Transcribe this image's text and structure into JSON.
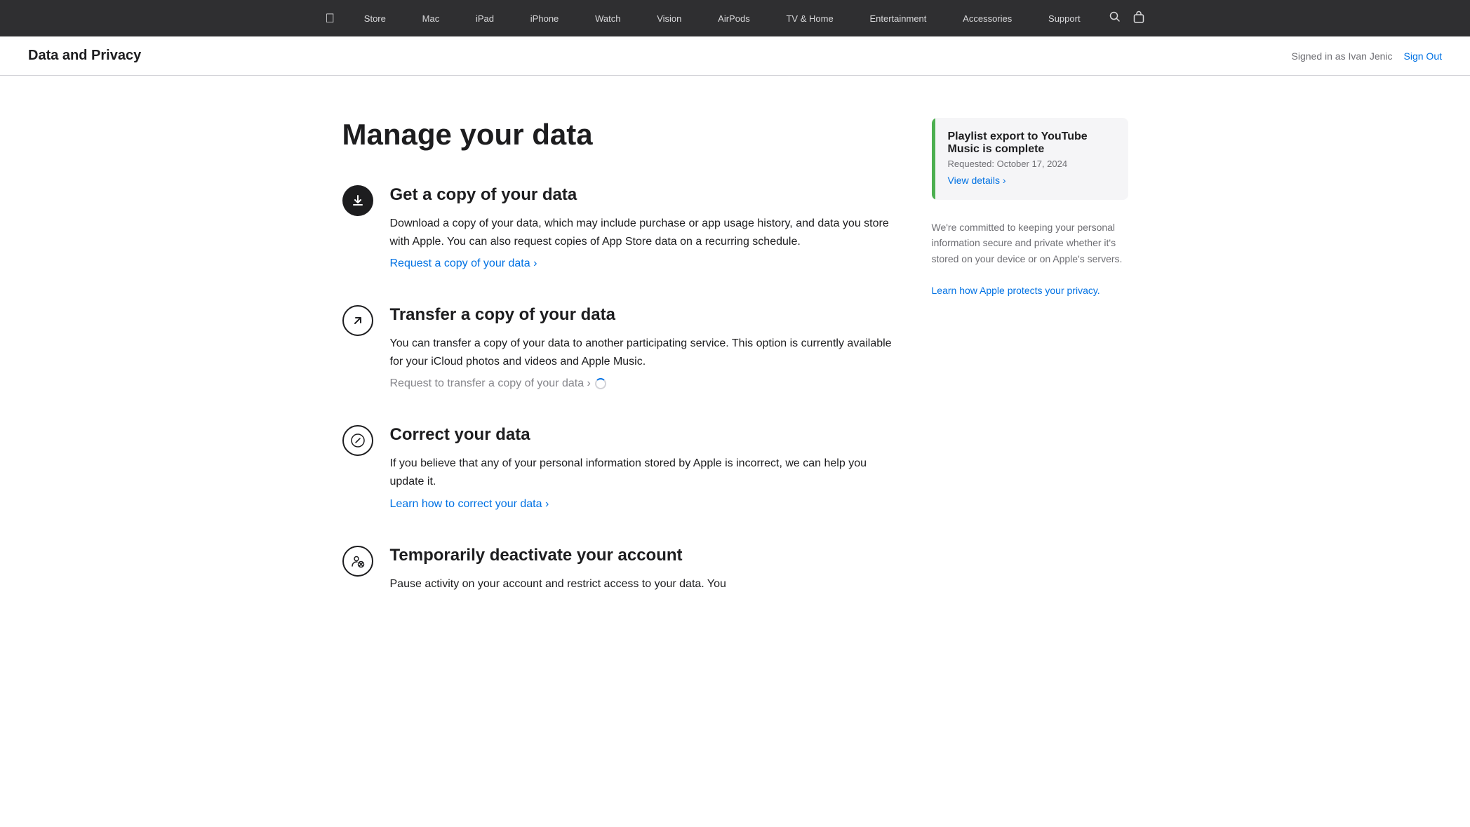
{
  "nav": {
    "apple_icon": "🍎",
    "items": [
      {
        "label": "Store",
        "id": "store"
      },
      {
        "label": "Mac",
        "id": "mac"
      },
      {
        "label": "iPad",
        "id": "ipad"
      },
      {
        "label": "iPhone",
        "id": "iphone"
      },
      {
        "label": "Watch",
        "id": "watch"
      },
      {
        "label": "Vision",
        "id": "vision"
      },
      {
        "label": "AirPods",
        "id": "airpods"
      },
      {
        "label": "TV & Home",
        "id": "tv-home"
      },
      {
        "label": "Entertainment",
        "id": "entertainment"
      },
      {
        "label": "Accessories",
        "id": "accessories"
      },
      {
        "label": "Support",
        "id": "support"
      }
    ]
  },
  "sub_header": {
    "title": "Data and Privacy",
    "signed_in_text": "Signed in as Ivan Jenic",
    "sign_out_label": "Sign Out"
  },
  "page": {
    "title": "Manage your data"
  },
  "sections": [
    {
      "id": "get-copy",
      "icon_type": "filled-download",
      "title": "Get a copy of your data",
      "description": "Download a copy of your data, which may include purchase or app usage history, and data you store with Apple. You can also request copies of App Store data on a recurring schedule.",
      "link_text": "Request a copy of your data ›",
      "link_active": true
    },
    {
      "id": "transfer-copy",
      "icon_type": "outline-arrow",
      "title": "Transfer a copy of your data",
      "description": "You can transfer a copy of your data to another participating service. This option is currently available for your iCloud photos and videos and Apple Music.",
      "link_text": "Request to transfer a copy of your data ›",
      "link_active": false,
      "loading": true
    },
    {
      "id": "correct",
      "icon_type": "outline-pencil",
      "title": "Correct your data",
      "description": "If you believe that any of your personal information stored by Apple is incorrect, we can help you update it.",
      "link_text": "Learn how to correct your data ›",
      "link_active": true
    },
    {
      "id": "deactivate",
      "icon_type": "outline-person",
      "title": "Temporarily deactivate your account",
      "description": "Pause activity on your account and restrict access to your data. You",
      "link_text": "",
      "link_active": false
    }
  ],
  "sidebar": {
    "notification": {
      "title": "Playlist export to YouTube Music is complete",
      "date": "Requested: October 17, 2024",
      "link_text": "View details ›"
    },
    "privacy": {
      "text": "We're committed to keeping your personal information secure and private whether it's stored on your device or on Apple's servers.",
      "link_text": "Learn how Apple protects your privacy."
    }
  }
}
